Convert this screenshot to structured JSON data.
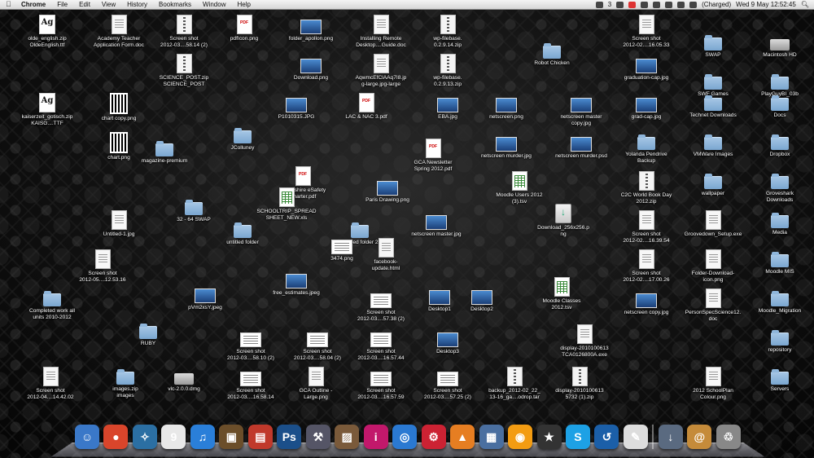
{
  "menubar": {
    "apple": "",
    "app_name": "Chrome",
    "menus": [
      "File",
      "Edit",
      "View",
      "History",
      "Bookmarks",
      "Window",
      "Help"
    ],
    "status_badge": "3",
    "battery": "(Charged)",
    "clock": "Wed 9 May  12:52:45"
  },
  "desktop": {
    "icons": [
      {
        "label": "olde_english.zip\nOldeEnglish.ttf",
        "kind": "font"
      },
      {
        "label": "Academy Teacher\nApplication Form.doc",
        "kind": "doc"
      },
      {
        "label": "Screen shot\n2012-03....58.14 (2)",
        "kind": "zip"
      },
      {
        "label": "pdfIcon.png",
        "kind": "pdf"
      },
      {
        "label": "folder_apollon.png",
        "kind": "img"
      },
      {
        "label": "Installing Remote\nDesktop....Guide.doc",
        "kind": "doc"
      },
      {
        "label": "wp-filebase.\n0.2.9.14.zip",
        "kind": "zip"
      },
      {
        "label": "Screen shot\n2012-02....16.05.33",
        "kind": "doc"
      },
      {
        "label": "SWAP",
        "kind": "folder"
      },
      {
        "label": "Macintosh HD",
        "kind": "disk"
      },
      {
        "label": "Robot Chicken",
        "kind": "folder"
      },
      {
        "label": "SCIENCE_POST.zip\nSCIENCE_POST",
        "kind": "zip"
      },
      {
        "label": "Download.png",
        "kind": "img"
      },
      {
        "label": "AqwmcEfClAAq7I8.jp\ng-large.jpg-large",
        "kind": "doc"
      },
      {
        "label": "wp-filebase.\n0.2.9.13.zip",
        "kind": "zip"
      },
      {
        "label": "graduation-cap.jpg",
        "kind": "img"
      },
      {
        "label": "SWF Games",
        "kind": "folder"
      },
      {
        "label": "PlayGuyBI_03b",
        "kind": "folder"
      },
      {
        "label": "kaiserzeit_gotisch.zip\nKAISG....TTF",
        "kind": "font"
      },
      {
        "label": "chart copy.png",
        "kind": "qr"
      },
      {
        "label": "P1010315.JPG",
        "kind": "img"
      },
      {
        "label": "LAC & NAC 3.pdf",
        "kind": "pdf"
      },
      {
        "label": "EBA.jpg",
        "kind": "img"
      },
      {
        "label": "netscreen.png",
        "kind": "img"
      },
      {
        "label": "netscreen master\ncopy.jpg",
        "kind": "img"
      },
      {
        "label": "grad-cap.jpg",
        "kind": "img"
      },
      {
        "label": "Technet Downloads",
        "kind": "folder"
      },
      {
        "label": "Docs",
        "kind": "folder"
      },
      {
        "label": "chart.png",
        "kind": "qr"
      },
      {
        "label": "magazine-premium",
        "kind": "folder"
      },
      {
        "label": "JColluney",
        "kind": "folder"
      },
      {
        "label": "GCA Newsletter\nSpring 2012.pdf",
        "kind": "pdf"
      },
      {
        "label": "netscreen murder.jpg",
        "kind": "img"
      },
      {
        "label": "netscreen murder.psd",
        "kind": "img"
      },
      {
        "label": "Yolanda Pendrive\nBackup",
        "kind": "folder"
      },
      {
        "label": "VMWare Images",
        "kind": "folder"
      },
      {
        "label": "Dropbox",
        "kind": "folder"
      },
      {
        "label": "Lancashire eSafety\nCharter.pdf",
        "kind": "pdf"
      },
      {
        "label": "Paris Drawing.png",
        "kind": "img"
      },
      {
        "label": "Moodle Users 2012\n(3).tsv",
        "kind": "xls"
      },
      {
        "label": "C2C World Book Day\n2012.zip",
        "kind": "zip"
      },
      {
        "label": "wallpaper",
        "kind": "folder"
      },
      {
        "label": "Groveshark\nDownloads",
        "kind": "folder"
      },
      {
        "label": "SCHOOLTRIP_SPREAD\nSHEET_NEW.xls",
        "kind": "xls"
      },
      {
        "label": "32 - 64 SWAP",
        "kind": "folder"
      },
      {
        "label": "Untitled-1.jpg",
        "kind": "doc"
      },
      {
        "label": "untitled folder",
        "kind": "folder"
      },
      {
        "label": "untitled folder 2",
        "kind": "folder"
      },
      {
        "label": "3474.png",
        "kind": "shot"
      },
      {
        "label": "netscreen master.jpg",
        "kind": "img"
      },
      {
        "label": "Download_256x256.p\nng",
        "kind": "pkg"
      },
      {
        "label": "Screen shot\n2012-02....16.39.54",
        "kind": "doc"
      },
      {
        "label": "Groovedown_Setup.exe",
        "kind": "doc"
      },
      {
        "label": "Media",
        "kind": "folder"
      },
      {
        "label": "facebook-\nupdate.html",
        "kind": "doc"
      },
      {
        "label": "Screen shot\n2012-05....12.53.16",
        "kind": "doc"
      },
      {
        "label": "free_estimates.jpeg",
        "kind": "img"
      },
      {
        "label": "Screen shot\n2012-02....17.00.26",
        "kind": "doc"
      },
      {
        "label": "Folder-Download-\nicon.png",
        "kind": "doc"
      },
      {
        "label": "Moodle MIS",
        "kind": "folder"
      },
      {
        "label": "Completed work all\nunits 2010-2012",
        "kind": "folder"
      },
      {
        "label": "pVm2xsY.jpeg",
        "kind": "img"
      },
      {
        "label": "Screen shot\n2012-03....57.38 (2)",
        "kind": "shot"
      },
      {
        "label": "Desktop1",
        "kind": "img"
      },
      {
        "label": "Desktop2",
        "kind": "img"
      },
      {
        "label": "Moodle Classes\n2012.tsv",
        "kind": "xls"
      },
      {
        "label": "netscreen copy.jpg",
        "kind": "img"
      },
      {
        "label": "PersonSpecScience12.\ndoc",
        "kind": "doc"
      },
      {
        "label": "Moodle_Migration",
        "kind": "folder"
      },
      {
        "label": "RUBY",
        "kind": "folder"
      },
      {
        "label": "Screen shot\n2012-03....58.10 (2)",
        "kind": "shot"
      },
      {
        "label": "Screen shot\n2012-03....58.04 (2)",
        "kind": "shot"
      },
      {
        "label": "Screen shot\n2012-03....16.57.44",
        "kind": "shot"
      },
      {
        "label": "Desktop3",
        "kind": "img"
      },
      {
        "label": "display-2010100613\nTCA0126800A.exe",
        "kind": "doc"
      },
      {
        "label": "repository",
        "kind": "folder"
      },
      {
        "label": "Screen shot\n2012-04....14.42.02",
        "kind": "doc"
      },
      {
        "label": "images.zip\nimages",
        "kind": "folder"
      },
      {
        "label": "vlc-2.0.0.dmg",
        "kind": "disk"
      },
      {
        "label": "Screen shot\n2012-03....16.58.14",
        "kind": "shot"
      },
      {
        "label": "GCA Outline -\nLarge.png",
        "kind": "doc"
      },
      {
        "label": "Screen shot\n2012-03....16.57.59",
        "kind": "shot"
      },
      {
        "label": "Screen shot\n2012-03....57.25 (2)",
        "kind": "shot"
      },
      {
        "label": "backup_2012-02_22_\n13-16_ga....odrop.tar",
        "kind": "zip"
      },
      {
        "label": "display-2010100613\n5732 (1).zip",
        "kind": "zip"
      },
      {
        "label": "2012 SchoolPlan\nColour.png",
        "kind": "doc"
      },
      {
        "label": "Servers",
        "kind": "folder"
      }
    ]
  },
  "dock": {
    "items": [
      {
        "name": "finder-icon",
        "glyph": "☺",
        "color": "#3a78c8"
      },
      {
        "name": "chrome-icon",
        "glyph": "●",
        "color": "#d9452b"
      },
      {
        "name": "twitter-bird-icon",
        "glyph": "✧",
        "color": "#2b6fa3"
      },
      {
        "name": "calendar-icon",
        "glyph": "9",
        "color": "#e8e8e8"
      },
      {
        "name": "itunes-icon",
        "glyph": "♫",
        "color": "#2a7fd9"
      },
      {
        "name": "iphoto-icon",
        "glyph": "▣",
        "color": "#6b4e2a"
      },
      {
        "name": "remote-desktop-icon",
        "glyph": "▤",
        "color": "#c0392b"
      },
      {
        "name": "photoshop-icon",
        "glyph": "Ps",
        "color": "#1b4f8a"
      },
      {
        "name": "xcode-icon",
        "glyph": "⚒",
        "color": "#556"
      },
      {
        "name": "preview-icon",
        "glyph": "▨",
        "color": "#7a5a3a"
      },
      {
        "name": "instapaper-icon",
        "glyph": "i",
        "color": "#c2186b"
      },
      {
        "name": "wifi-icon",
        "glyph": "◎",
        "color": "#2a79d2"
      },
      {
        "name": "transmission-icon",
        "glyph": "⚙",
        "color": "#c23"
      },
      {
        "name": "vlc-icon",
        "glyph": "▲",
        "color": "#e67e22"
      },
      {
        "name": "iphoto-albums-icon",
        "glyph": "▦",
        "color": "#4a6fa0"
      },
      {
        "name": "webcam-icon",
        "glyph": "◉",
        "color": "#f39c12"
      },
      {
        "name": "imovie-icon",
        "glyph": "★",
        "color": "#333"
      },
      {
        "name": "skype-icon",
        "glyph": "S",
        "color": "#1da1e5"
      },
      {
        "name": "time-machine-icon",
        "glyph": "↺",
        "color": "#1b5fa8"
      },
      {
        "name": "script-editor-icon",
        "glyph": "✎",
        "color": "#ddd"
      },
      {
        "name": "downloads-stack-icon",
        "glyph": "↓",
        "color": "#5a6a80"
      },
      {
        "name": "documents-stack-icon",
        "glyph": "@",
        "color": "#c58b3a"
      },
      {
        "name": "trash-icon",
        "glyph": "♲",
        "color": "#888"
      }
    ]
  }
}
